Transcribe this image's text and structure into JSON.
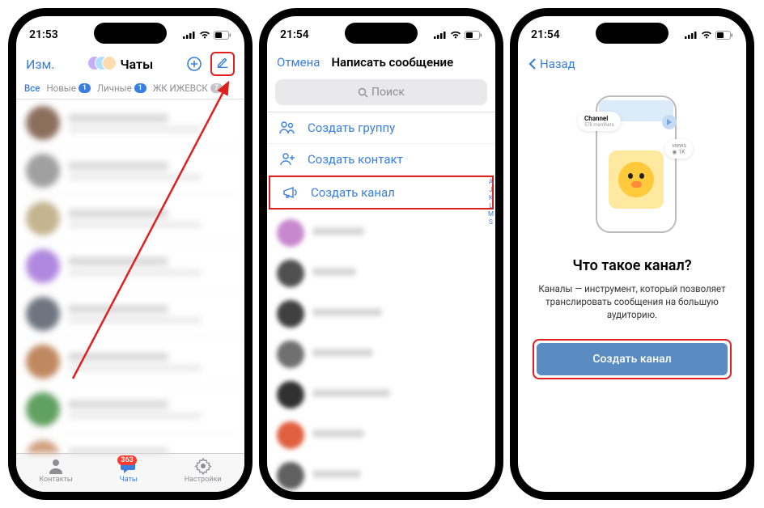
{
  "phone1": {
    "time": "21:53",
    "edit": "Изм.",
    "title": "Чаты",
    "tabs": {
      "all": "Все",
      "new": "Новые",
      "personal": "Личные",
      "project": "ЖК ИЖЕВСК",
      "new_badge": "1",
      "personal_badge": "1",
      "project_badge": "7"
    },
    "tabbar": {
      "contacts": "Контакты",
      "chats": "Чаты",
      "settings": "Настройки",
      "badge": "363"
    }
  },
  "phone2": {
    "time": "21:54",
    "cancel": "Отмена",
    "title": "Написать сообщение",
    "search": "Поиск",
    "opt_group": "Создать группу",
    "opt_contact": "Создать контакт",
    "opt_channel": "Создать канал",
    "index": [
      "A",
      "J",
      "K",
      "L",
      "M",
      "S"
    ]
  },
  "phone3": {
    "time": "21:54",
    "back": "Назад",
    "illus_channel": "Channel",
    "illus_members": "57k members",
    "illus_views": "views",
    "illus_views_count": "◉ 1K",
    "heading": "Что такое канал?",
    "desc": "Каналы — инструмент, который позволяет транслировать сообщения на большую аудиторию.",
    "cta": "Создать канал"
  }
}
